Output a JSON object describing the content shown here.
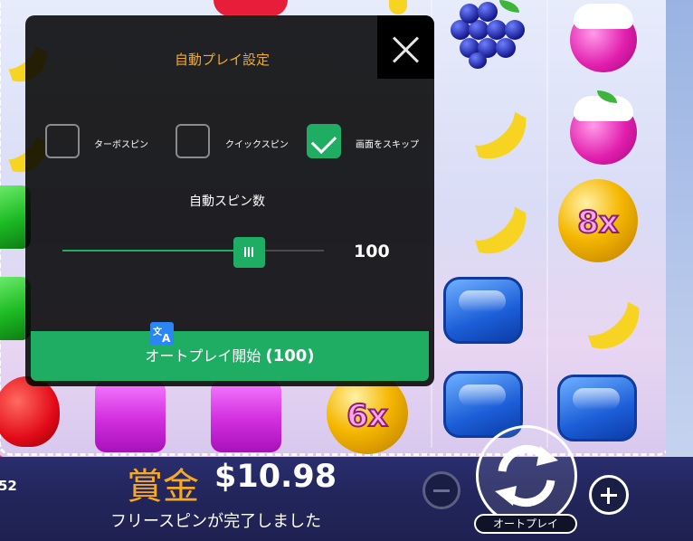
{
  "dialog": {
    "title": "自動プレイ設定",
    "options": [
      {
        "label": "ターボスピン",
        "checked": false
      },
      {
        "label": "クイックスピン",
        "checked": false
      },
      {
        "label": "画面をスキップ",
        "checked": true
      }
    ],
    "spin_count_label": "自動スピン数",
    "spin_count_value": "100",
    "slider_level": 0.66,
    "start_button_label": "オートプレイ開始",
    "start_button_count": "(100)"
  },
  "game": {
    "multipliers": [
      "8x",
      "6x"
    ]
  },
  "bottom_bar": {
    "balance_partial": "52",
    "win_label": "賞金",
    "win_amount": "$10.98",
    "win_message": "フリースピンが完了しました",
    "autoplay_label": "オートプレイ"
  },
  "icons": {
    "close": "close-icon",
    "minus": "minus-icon",
    "plus": "plus-icon",
    "spin": "spin-arrows-icon",
    "translate": "translate-icon"
  },
  "colors": {
    "accent_green": "#1fad63",
    "title_orange": "#f7a926",
    "border_red": "#e9465c"
  }
}
